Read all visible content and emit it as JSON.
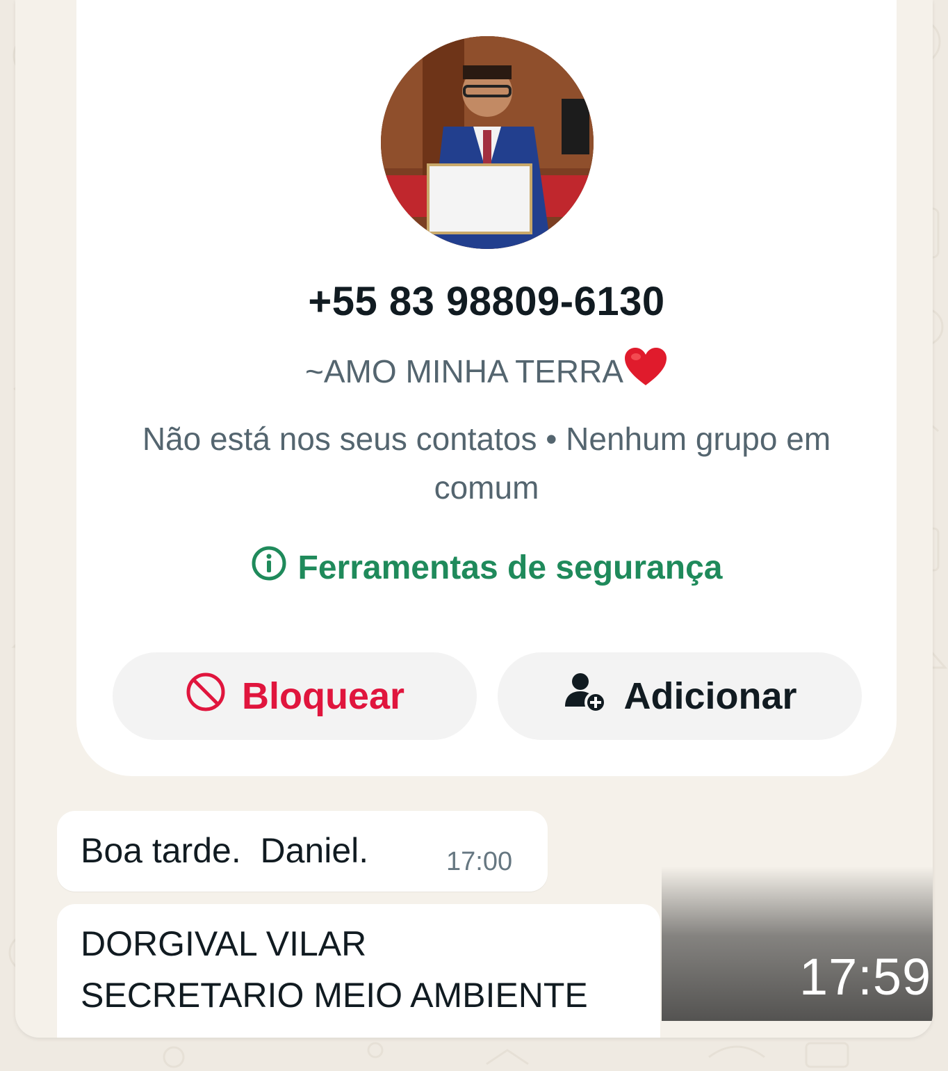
{
  "contact": {
    "phone": "+55 83 98809-6130",
    "status": "~AMO MINHA TERRA",
    "status_emoji": "red-heart-icon",
    "info": "Não está nos seus contatos • Nenhum grupo em comum",
    "safety_tools": "Ferramentas de segurança",
    "avatar": "profile-photo"
  },
  "actions": {
    "block_label": "Bloquear",
    "add_label": "Adicionar"
  },
  "messages": [
    {
      "text": "Boa tarde.  Daniel.",
      "time": "17:00"
    },
    {
      "line1": "DORGIVAL VILAR",
      "line2": "SECRETARIO MEIO AMBIENTE"
    }
  ],
  "overlay_time": "17:59",
  "colors": {
    "accent_green": "#1f8a5b",
    "block_red": "#e0153d",
    "wallpaper": "#efeae2"
  }
}
